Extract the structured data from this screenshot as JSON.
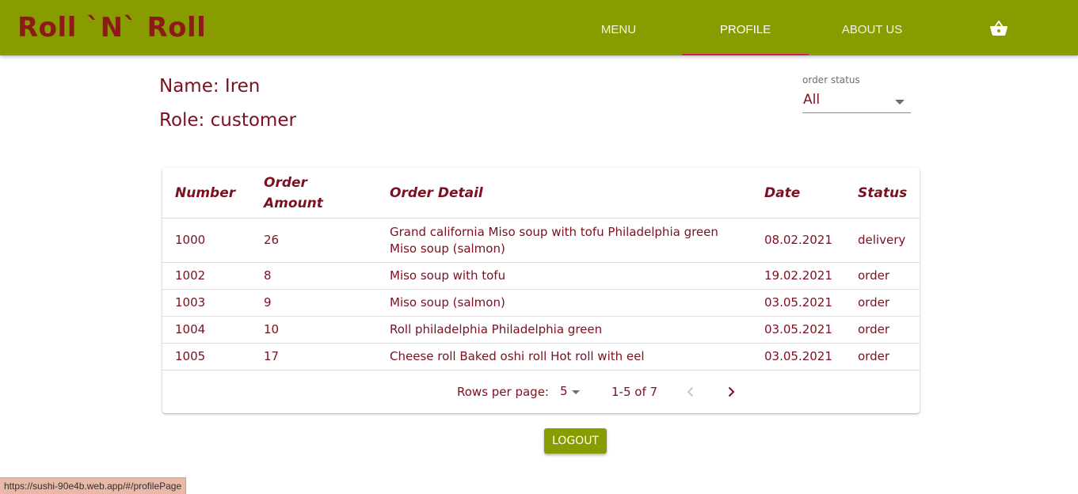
{
  "header": {
    "logo": "Roll `N` Roll",
    "nav": [
      {
        "label": "MENU"
      },
      {
        "label": "PROFILE"
      },
      {
        "label": "ABOUT US"
      }
    ],
    "cart_icon": "shopping-basket-icon"
  },
  "profile": {
    "name_line": "Name: Iren",
    "role_line": "Role: customer"
  },
  "status_filter": {
    "label": "order status",
    "value": "All"
  },
  "table": {
    "columns": [
      "Number",
      "Order Amount",
      "Order Detail",
      "Date",
      "Status"
    ],
    "rows": [
      {
        "number": "1000",
        "amount": "26",
        "detail": "Grand california Miso soup with tofu Philadelphia green Miso soup (salmon)",
        "date": "08.02.2021",
        "status": "delivery"
      },
      {
        "number": "1002",
        "amount": "8",
        "detail": "Miso soup with tofu",
        "date": "19.02.2021",
        "status": "order"
      },
      {
        "number": "1003",
        "amount": "9",
        "detail": "Miso soup (salmon)",
        "date": "03.05.2021",
        "status": "order"
      },
      {
        "number": "1004",
        "amount": "10",
        "detail": "Roll philadelphia Philadelphia green",
        "date": "03.05.2021",
        "status": "order"
      },
      {
        "number": "1005",
        "amount": "17",
        "detail": "Cheese roll Baked oshi roll Hot roll with eel",
        "date": "03.05.2021",
        "status": "order"
      }
    ]
  },
  "pagination": {
    "rows_label": "Rows per page:",
    "rows_value": "5",
    "range": "1-5 of 7"
  },
  "logout_label": "LOGOUT",
  "status_url": "https://sushi-90e4b.web.app/#/profilePage",
  "colors": {
    "brand": "#889c00",
    "text": "#7a1020",
    "logo": "#8e1a17",
    "tab_indicator": "#d81b60"
  }
}
